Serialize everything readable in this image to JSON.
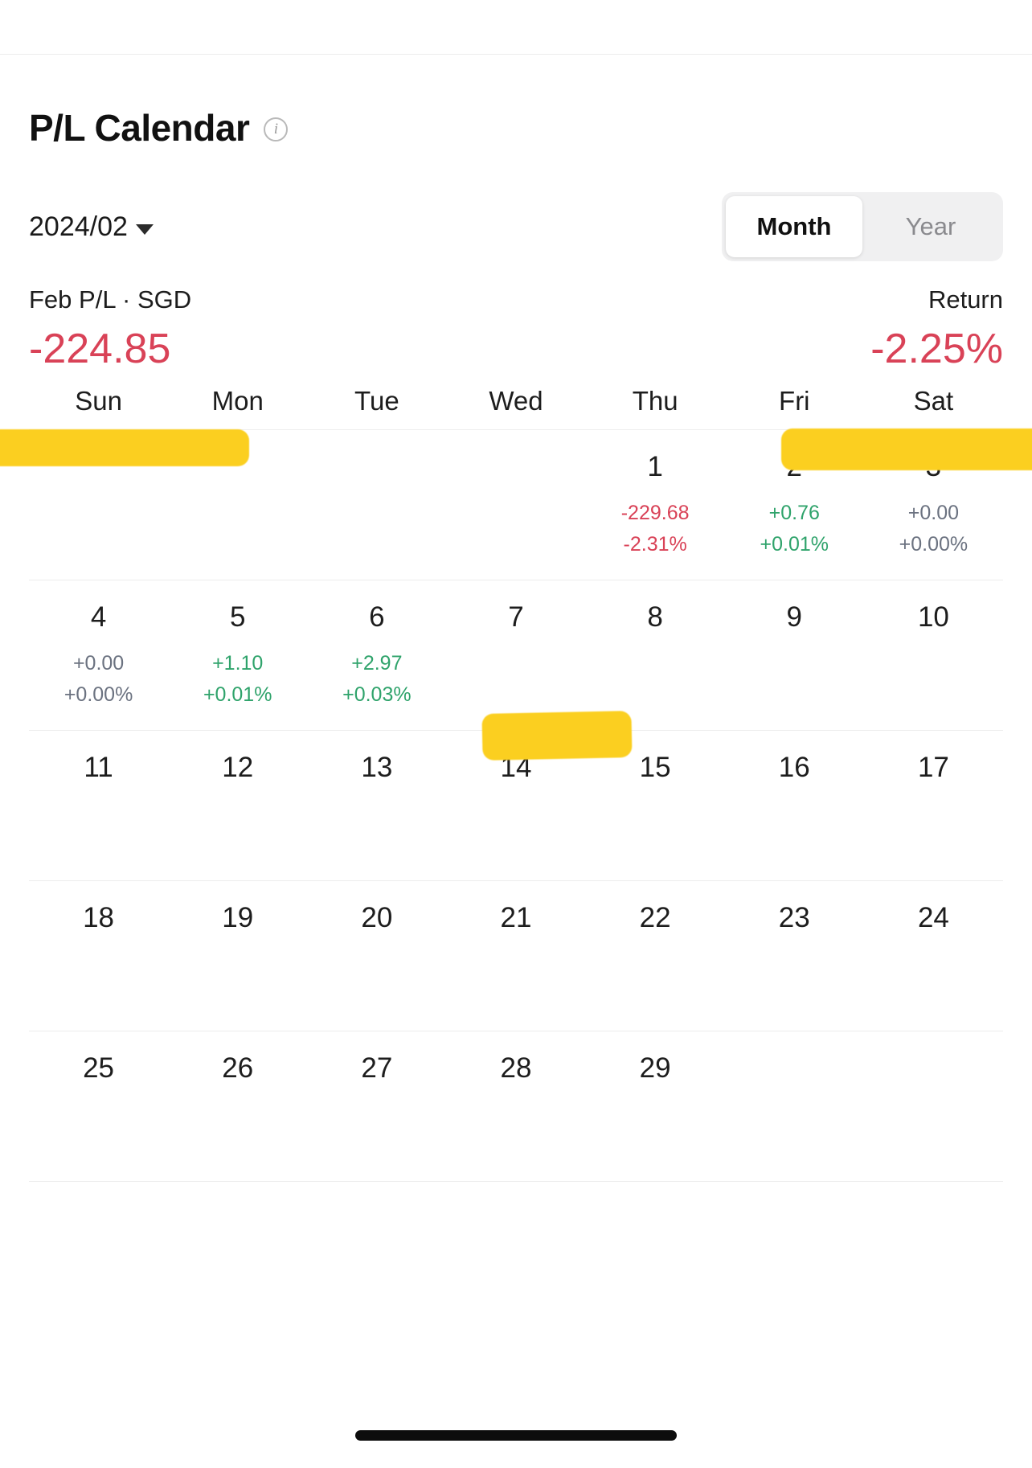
{
  "header": {
    "title": "P/L Calendar",
    "info_icon": "info-icon"
  },
  "controls": {
    "period": "2024/02",
    "caret_icon": "chevron-down-icon",
    "toggle": {
      "options": [
        "Month",
        "Year"
      ],
      "selected": "Month"
    }
  },
  "summary": {
    "pl_label": "Feb P/L · SGD",
    "pl_value": "-224.85",
    "pl_sign": "neg",
    "return_label": "Return",
    "return_value": "-2.25%",
    "return_sign": "neg"
  },
  "colors": {
    "negative": "#d94257",
    "positive": "#2fa36b",
    "zero": "#6b7280",
    "highlight": "#fbcf20"
  },
  "calendar": {
    "weekdays": [
      "Sun",
      "Mon",
      "Tue",
      "Wed",
      "Thu",
      "Fri",
      "Sat"
    ],
    "weeks": [
      [
        {
          "day": "",
          "pl": "",
          "pct": "",
          "sign": ""
        },
        {
          "day": "",
          "pl": "",
          "pct": "",
          "sign": ""
        },
        {
          "day": "",
          "pl": "",
          "pct": "",
          "sign": ""
        },
        {
          "day": "",
          "pl": "",
          "pct": "",
          "sign": ""
        },
        {
          "day": "1",
          "pl": "-229.68",
          "pct": "-2.31%",
          "sign": "neg"
        },
        {
          "day": "2",
          "pl": "+0.76",
          "pct": "+0.01%",
          "sign": "pos"
        },
        {
          "day": "3",
          "pl": "+0.00",
          "pct": "+0.00%",
          "sign": "zero"
        }
      ],
      [
        {
          "day": "4",
          "pl": "+0.00",
          "pct": "+0.00%",
          "sign": "zero"
        },
        {
          "day": "5",
          "pl": "+1.10",
          "pct": "+0.01%",
          "sign": "pos"
        },
        {
          "day": "6",
          "pl": "+2.97",
          "pct": "+0.03%",
          "sign": "pos"
        },
        {
          "day": "7",
          "pl": "",
          "pct": "",
          "sign": ""
        },
        {
          "day": "8",
          "pl": "",
          "pct": "",
          "sign": ""
        },
        {
          "day": "9",
          "pl": "",
          "pct": "",
          "sign": ""
        },
        {
          "day": "10",
          "pl": "",
          "pct": "",
          "sign": ""
        }
      ],
      [
        {
          "day": "11",
          "pl": "",
          "pct": "",
          "sign": ""
        },
        {
          "day": "12",
          "pl": "",
          "pct": "",
          "sign": ""
        },
        {
          "day": "13",
          "pl": "",
          "pct": "",
          "sign": ""
        },
        {
          "day": "14",
          "pl": "",
          "pct": "",
          "sign": ""
        },
        {
          "day": "15",
          "pl": "",
          "pct": "",
          "sign": ""
        },
        {
          "day": "16",
          "pl": "",
          "pct": "",
          "sign": ""
        },
        {
          "day": "17",
          "pl": "",
          "pct": "",
          "sign": ""
        }
      ],
      [
        {
          "day": "18",
          "pl": "",
          "pct": "",
          "sign": ""
        },
        {
          "day": "19",
          "pl": "",
          "pct": "",
          "sign": ""
        },
        {
          "day": "20",
          "pl": "",
          "pct": "",
          "sign": ""
        },
        {
          "day": "21",
          "pl": "",
          "pct": "",
          "sign": ""
        },
        {
          "day": "22",
          "pl": "",
          "pct": "",
          "sign": ""
        },
        {
          "day": "23",
          "pl": "",
          "pct": "",
          "sign": ""
        },
        {
          "day": "24",
          "pl": "",
          "pct": "",
          "sign": ""
        }
      ],
      [
        {
          "day": "25",
          "pl": "",
          "pct": "",
          "sign": ""
        },
        {
          "day": "26",
          "pl": "",
          "pct": "",
          "sign": ""
        },
        {
          "day": "27",
          "pl": "",
          "pct": "",
          "sign": ""
        },
        {
          "day": "28",
          "pl": "",
          "pct": "",
          "sign": ""
        },
        {
          "day": "29",
          "pl": "",
          "pct": "",
          "sign": ""
        },
        {
          "day": "",
          "pl": "",
          "pct": "",
          "sign": ""
        },
        {
          "day": "",
          "pl": "",
          "pct": "",
          "sign": ""
        }
      ]
    ]
  },
  "annotations": [
    {
      "name": "highlight-pl-value",
      "shape": "marker-stroke"
    },
    {
      "name": "highlight-return-value",
      "shape": "marker-stroke"
    },
    {
      "name": "highlight-day-8",
      "shape": "marker-stroke"
    }
  ]
}
